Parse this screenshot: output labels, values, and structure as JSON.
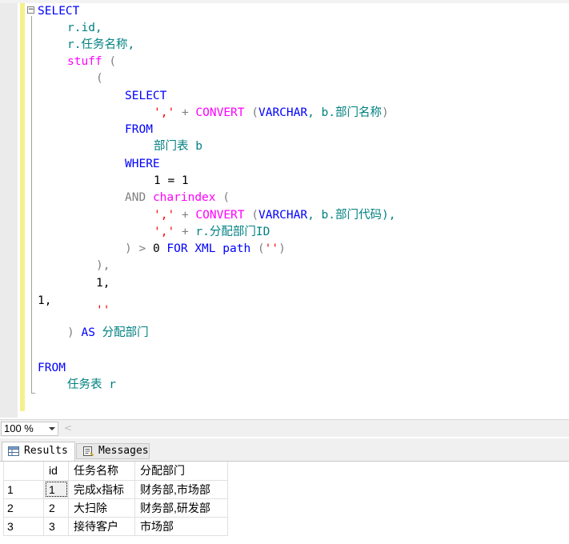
{
  "editor": {
    "collapse_glyph": "−",
    "lines": {
      "l1": "SELECT",
      "l2": "r.id,",
      "l3": "r.任务名称,",
      "l4_fn": "stuff",
      "l4_paren": "(",
      "l5": "(",
      "l6": "SELECT",
      "l7_str": "','",
      "l7_plus": "+",
      "l7_fn": "CONVERT",
      "l7_open": "(",
      "l7_type": "VARCHAR",
      "l7_rest": ", b.部门名称",
      "l7_close": ")",
      "l8": "FROM",
      "l9": "部门表 b",
      "l10": "WHERE",
      "l11": "1 = 1",
      "l12_kw": "AND",
      "l12_fn": "charindex",
      "l12_paren": "(",
      "l13_str": "','",
      "l13_plus": "+",
      "l13_fn": "CONVERT",
      "l13_open": "(",
      "l13_type": "VARCHAR",
      "l13_rest": ", b.部门代码),",
      "l14_str": "','",
      "l14_plus": "+",
      "l14_rest": "r.分配部门ID",
      "l15_close": ")",
      "l15_gt": ">",
      "l15_zero": "0",
      "l15_for": "FOR XML",
      "l15_path": "path",
      "l15_open": "(",
      "l15_str": "''",
      "l15_end": ")",
      "l16": "),",
      "l17": "1,",
      "l18": "1,",
      "l19": "''",
      "l20_paren": ")",
      "l20_kw": "AS",
      "l20_alias": "分配部门",
      "l21": "FROM",
      "l22": "任务表 r"
    }
  },
  "zoom": {
    "value": "100 %",
    "scroll_left_glyph": "<"
  },
  "tabs": {
    "results": "Results",
    "messages": "Messages"
  },
  "results": {
    "columns": [
      "id",
      "任务名称",
      "分配部门"
    ],
    "rows": [
      {
        "n": "1",
        "id": "1",
        "name": "完成x指标",
        "dept": "财务部,市场部"
      },
      {
        "n": "2",
        "id": "2",
        "name": "大扫除",
        "dept": "财务部,研发部"
      },
      {
        "n": "3",
        "id": "3",
        "name": "接待客户",
        "dept": "市场部"
      }
    ]
  },
  "colors": {
    "keyword": "#0000ff",
    "function": "#ff00ff",
    "string": "#ff0000",
    "operator": "#808080",
    "object": "#008080",
    "change_bar": "#f5f08a"
  }
}
